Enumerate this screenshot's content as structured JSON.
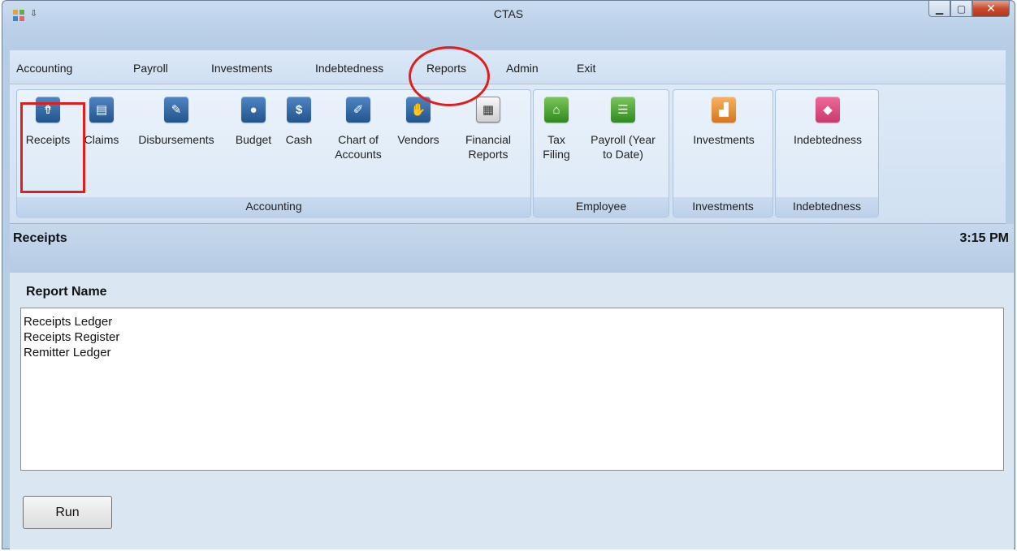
{
  "window": {
    "title": "CTAS"
  },
  "menu": [
    {
      "label": "Accounting"
    },
    {
      "label": "Payroll"
    },
    {
      "label": "Investments"
    },
    {
      "label": "Indebtedness"
    },
    {
      "label": "Reports"
    },
    {
      "label": "Admin"
    },
    {
      "label": "Exit"
    }
  ],
  "ribbon": {
    "groups": [
      {
        "label": "Accounting"
      },
      {
        "label": "Employee"
      },
      {
        "label": "Investments"
      },
      {
        "label": "Indebtedness"
      }
    ],
    "buttons": [
      {
        "label": "Receipts",
        "icon": "receipts-icon",
        "glyph": "⇮"
      },
      {
        "label": "Claims",
        "icon": "claims-icon",
        "glyph": "▤"
      },
      {
        "label": "Disbursements",
        "icon": "disbursements-icon",
        "glyph": "✎"
      },
      {
        "label": "Budget",
        "icon": "piggy-bank-icon",
        "glyph": "●"
      },
      {
        "label": "Cash",
        "icon": "cash-icon",
        "glyph": "$"
      },
      {
        "label": "Chart of\nAccounts",
        "icon": "chart-of-accounts-icon",
        "glyph": "✐"
      },
      {
        "label": "Vendors",
        "icon": "handshake-icon",
        "glyph": "✋"
      },
      {
        "label": "Financial\nReports",
        "icon": "calculator-icon",
        "glyph": "▦"
      },
      {
        "label": "Tax\nFiling",
        "icon": "bank-building-icon",
        "glyph": "⌂"
      },
      {
        "label": "Payroll (Year\nto Date)",
        "icon": "payroll-document-icon",
        "glyph": "☰"
      },
      {
        "label": "Investments",
        "icon": "investment-chart-icon",
        "glyph": "▟"
      },
      {
        "label": "Indebtedness",
        "icon": "indebtedness-icon",
        "glyph": "◆"
      }
    ]
  },
  "header": {
    "title": "Receipts",
    "time": "3:15 PM"
  },
  "content": {
    "heading": "Report Name",
    "reports": [
      "Receipts Ledger",
      "Receipts Register",
      "Remitter Ledger"
    ],
    "run_label": "Run"
  },
  "colors": {
    "highlight": "#e01e1e",
    "accent": "#23548c"
  }
}
